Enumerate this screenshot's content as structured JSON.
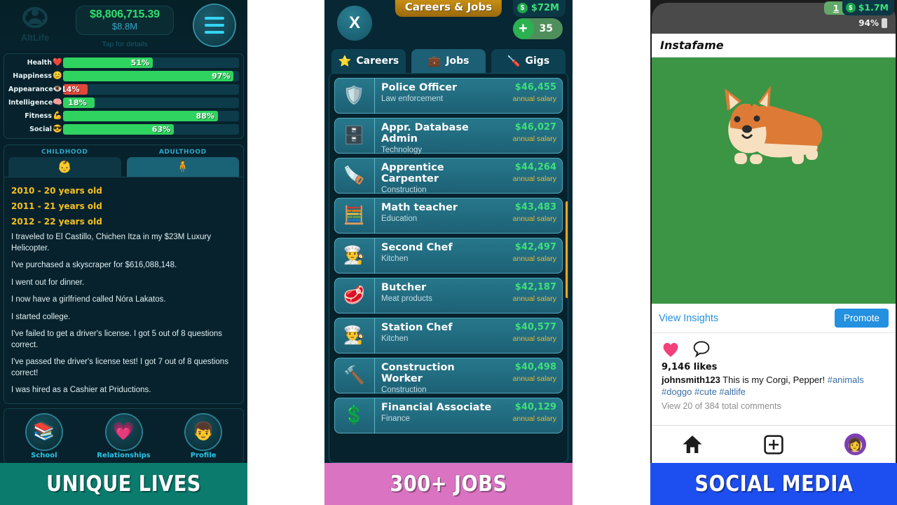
{
  "panels": {
    "left": {
      "banner": {
        "text": "UNIQUE LIVES",
        "bg": "#0a7b6c"
      },
      "logo": {
        "name": "AltLife"
      },
      "money": {
        "amount": "$8,806,715.39",
        "short": "$8.8M",
        "hint": "Tap for details"
      },
      "menu_label": "menu",
      "stats": [
        {
          "label": "Health",
          "icon": "❤️",
          "value": 51,
          "display": "51%",
          "color": "#2fd35f"
        },
        {
          "label": "Happiness",
          "icon": "😊",
          "value": 97,
          "display": "97%",
          "color": "#2fd35f"
        },
        {
          "label": "Appearance",
          "icon": "👁️",
          "value": 14,
          "display": "14%",
          "color": "#e0483a"
        },
        {
          "label": "Intelligence",
          "icon": "🧠",
          "value": 18,
          "display": "18%",
          "color": "#2fd35f"
        },
        {
          "label": "Fitness",
          "icon": "💪",
          "value": 88,
          "display": "88%",
          "color": "#2fd35f"
        },
        {
          "label": "Social",
          "icon": "😎",
          "value": 63,
          "display": "63%",
          "color": "#2fd35f"
        }
      ],
      "life_tabs": [
        {
          "label": "CHILDHOOD",
          "icon": "👶",
          "active": false
        },
        {
          "label": "ADULTHOOD",
          "icon": "🧍",
          "active": true
        }
      ],
      "timeline": [
        {
          "type": "year",
          "text": "2010 - 20 years old"
        },
        {
          "type": "year",
          "text": "2011 - 21 years old"
        },
        {
          "type": "year",
          "text": "2012 - 22 years old"
        },
        {
          "type": "event",
          "text": "I traveled to El Castillo, Chichen Itza in my $23M Luxury Helicopter."
        },
        {
          "type": "event",
          "text": "I've purchased a skyscraper for $616,088,148."
        },
        {
          "type": "event",
          "text": "I went out for dinner."
        },
        {
          "type": "event",
          "text": "I now have a girlfriend called Nóra Lakatos."
        },
        {
          "type": "event",
          "text": "I started college."
        },
        {
          "type": "event",
          "text": "I've failed to get a driver's license. I got 5 out of 8 questions correct."
        },
        {
          "type": "event",
          "text": "I've passed the driver's license test! I got 7 out of 8 questions correct!"
        },
        {
          "type": "event",
          "text": "I was hired as a Cashier at Priductions."
        }
      ],
      "nav": [
        {
          "label": "School",
          "icon": "📚"
        },
        {
          "label": "Relationships",
          "icon": "💗"
        },
        {
          "label": "Profile",
          "icon": "👦"
        }
      ]
    },
    "middle": {
      "banner": {
        "text": "300+ JOBS",
        "bg": "#d973c2"
      },
      "title": "Careers & Jobs",
      "close_label": "X",
      "cash": {
        "icon": "$",
        "value": "$72M"
      },
      "gems": {
        "plus": "+",
        "value": "35"
      },
      "tabs": [
        {
          "label": "Careers",
          "icon": "⭐",
          "active": false
        },
        {
          "label": "Jobs",
          "icon": "💼",
          "active": true
        },
        {
          "label": "Gigs",
          "icon": "🪛",
          "active": false
        }
      ],
      "salary_note": "annual salary",
      "jobs": [
        {
          "title": "Police Officer",
          "category": "Law enforcement",
          "salary": "$46,455",
          "icon": "🛡️"
        },
        {
          "title": "Appr. Database Admin",
          "category": "Technology",
          "salary": "$46,027",
          "icon": "🗄️"
        },
        {
          "title": "Apprentice Carpenter",
          "category": "Construction",
          "salary": "$44,264",
          "icon": "🪚"
        },
        {
          "title": "Math teacher",
          "category": "Education",
          "salary": "$43,483",
          "icon": "🧮"
        },
        {
          "title": "Second Chef",
          "category": "Kitchen",
          "salary": "$42,497",
          "icon": "👨‍🍳"
        },
        {
          "title": "Butcher",
          "category": "Meat products",
          "salary": "$42,187",
          "icon": "🥩"
        },
        {
          "title": "Station Chef",
          "category": "Kitchen",
          "salary": "$40,577",
          "icon": "👨‍🍳"
        },
        {
          "title": "Construction Worker",
          "category": "Construction",
          "salary": "$40,498",
          "icon": "🔨"
        },
        {
          "title": "Financial Associate",
          "category": "Finance",
          "salary": "$40,129",
          "icon": "💲"
        }
      ]
    },
    "right": {
      "banner": {
        "text": "SOCIAL MEDIA",
        "bg": "#1d4ef0"
      },
      "overlay": {
        "badge": "1",
        "cash_icon": "$",
        "cash": "$1.7M"
      },
      "status": {
        "battery": "94%"
      },
      "app_name": "Instafame",
      "post": {
        "view_insights": "View Insights",
        "promote": "Promote",
        "likes": "9,146 likes",
        "username": "johnsmith123",
        "caption": " This is my Corgi, Pepper! ",
        "hashtags": "#animals #doggo #cute #altlife",
        "comments": "View 20 of 384 total comments"
      },
      "nav": {
        "home": "🏠",
        "add": "+",
        "avatar": "👩"
      }
    }
  }
}
